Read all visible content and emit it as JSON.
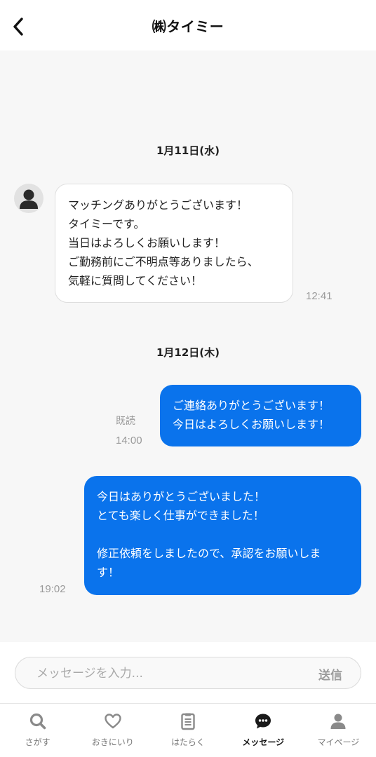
{
  "header": {
    "title": "㈱タイミー"
  },
  "chat": {
    "dates": [
      "1月11日(水)",
      "1月12日(木)"
    ],
    "messages": [
      {
        "direction": "incoming",
        "text": "マッチングありがとうございます！\nタイミーです。\n当日はよろしくお願いします！\nご勤務前にご不明点等ありましたら、\n気軽に質問してください！",
        "time": "12:41"
      },
      {
        "direction": "outgoing",
        "text": "ご連絡ありがとうございます！\n今日はよろしくお願いします！",
        "time": "14:00",
        "read": "既読"
      },
      {
        "direction": "outgoing",
        "text": "今日はありがとうございました！\nとても楽しく仕事ができました！\n\n修正依頼をしましたので、承認をお願いしま\nす！",
        "time": "19:02"
      }
    ]
  },
  "composer": {
    "placeholder": "メッセージを入力...",
    "send_label": "送信"
  },
  "tabs": [
    {
      "label": "さがす",
      "icon": "search-icon",
      "active": false
    },
    {
      "label": "おきにいり",
      "icon": "heart-icon",
      "active": false
    },
    {
      "label": "はたらく",
      "icon": "clipboard-icon",
      "active": false
    },
    {
      "label": "メッセージ",
      "icon": "chat-icon",
      "active": true
    },
    {
      "label": "マイページ",
      "icon": "user-icon",
      "active": false
    }
  ],
  "colors": {
    "accent": "#0a73ec",
    "background": "#f7f7f7",
    "muted": "#999999"
  }
}
